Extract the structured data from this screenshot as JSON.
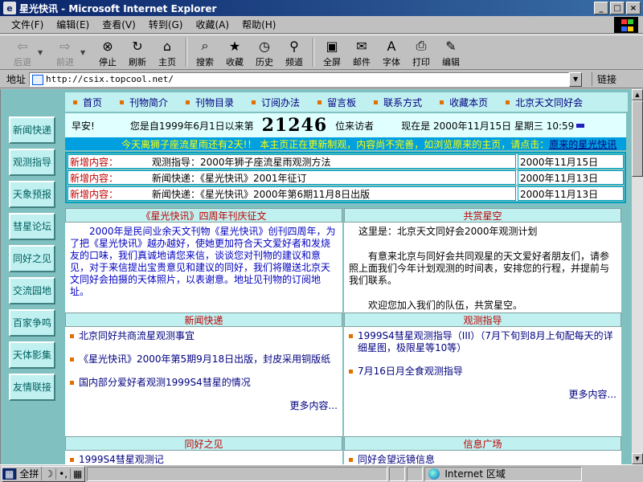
{
  "window": {
    "title": "星光快讯 - Microsoft Internet Explorer",
    "min": "_",
    "max": "□",
    "close": "×"
  },
  "menu": [
    "文件(F)",
    "编辑(E)",
    "查看(V)",
    "转到(G)",
    "收藏(A)",
    "帮助(H)"
  ],
  "toolbar": {
    "back": "后退",
    "forward": "前进",
    "stop": "停止",
    "refresh": "刷新",
    "home": "主页",
    "search": "搜索",
    "favorites": "收藏",
    "history": "历史",
    "channels": "频道",
    "fullscreen": "全屏",
    "mail": "邮件",
    "fonts": "字体",
    "print": "打印",
    "edit": "编辑"
  },
  "address": {
    "label": "地址",
    "url": "http://csix.topcool.net/",
    "links": "链接"
  },
  "topnav": [
    "首页",
    "刊物简介",
    "刊物目录",
    "订阅办法",
    "留言板",
    "联系方式",
    "收藏本页",
    "北京天文同好会"
  ],
  "sidebar": [
    "新闻快递",
    "观测指导",
    "天象预报",
    "彗星论坛",
    "同好之见",
    "交流园地",
    "百家争鸣",
    "天体影集",
    "友情联接"
  ],
  "welcome": {
    "greeting": "早安!",
    "since": "您是自1999年6月1日以来第",
    "count": "21246",
    "visitor": "位来访者",
    "now": "现在是 2000年11月15日 星期三 10:59"
  },
  "marquee": {
    "text": "今天离狮子座流星雨还有2天!！   本主页正在更新制观，内容尚不完善，如浏览原来的主页，请点击：",
    "link": "原来的星光快讯"
  },
  "news": [
    {
      "tag": "新增内容：",
      "title": "观测指导：2000年狮子座流星雨观测方法",
      "date": "2000年11月15日"
    },
    {
      "tag": "新增内容：",
      "title": "新闻快递：《星光快讯》2001年征订",
      "date": "2000年11月13日"
    },
    {
      "tag": "新增内容：",
      "title": "新闻快递：《星光快讯》2000年第6期11月8日出版",
      "date": "2000年11月13日"
    }
  ],
  "panels": {
    "anniversary": {
      "title": "《星光快讯》四周年刊庆征文",
      "body": "　　2000年是民间业余天文刊物《星光快讯》创刊四周年，为了把《星光快讯》越办越好，使她更加符合天文爱好者和发烧友的口味，我们真诚地请您来信，谈谈您对刊物的建议和意见，对于来信提出宝贵意见和建议的同好，我们将赠送北京天文同好会拍摄的天体照片，以表谢意。地址见刊物的订阅地址。"
    },
    "sky": {
      "title": "共赏星空",
      "p1": "　这里是：北京天文同好会2000年观测计划",
      "p2": "　　有意来北京与同好会共同观星的天文爱好者朋友们，请参照上面我们今年计划观测的时间表，安排您的行程，并提前与我们联系。",
      "p3": "　　欢迎您加入我们的队伍，共赏星空。"
    },
    "newsfast": {
      "title": "新闻快递",
      "items": [
        "北京同好共商流星观测事宜",
        "《星光快讯》2000年第5期9月18日出版，封皮采用铜版纸",
        "国内部分爱好者观测1999S4彗星的情况"
      ],
      "more": "更多内容..."
    },
    "guide": {
      "title": "观测指导",
      "items": [
        "1999S4彗星观测指导（III）（7月下旬到8月上旬配每天的详细星图，极限星等10等）",
        "7月16日月全食观测指导"
      ],
      "more": "更多内容..."
    },
    "views": {
      "title": "同好之见",
      "items": [
        "1999S4彗星观测记"
      ]
    },
    "info": {
      "title": "信息广场",
      "items": [
        "同好会望远镜信息"
      ]
    }
  },
  "status": {
    "ime": [
      "全拼",
      "☽",
      "•,",
      "▦"
    ],
    "zone": "Internet 区域"
  }
}
